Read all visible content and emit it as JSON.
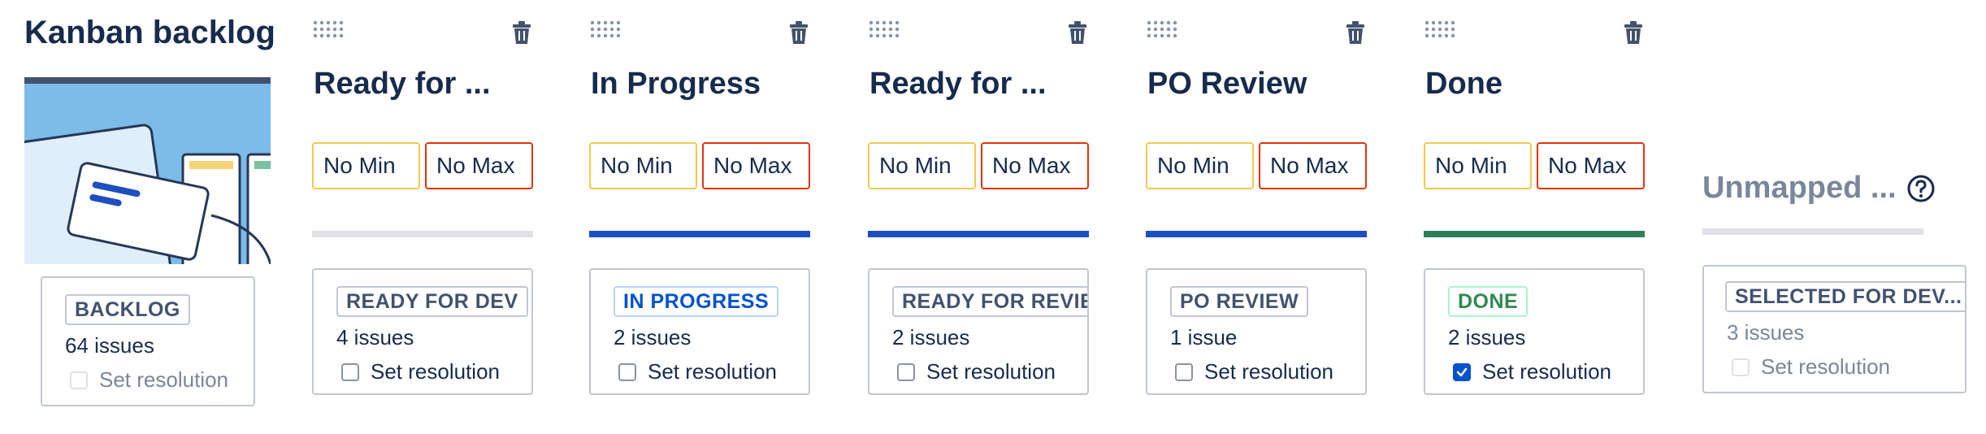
{
  "backlog": {
    "title": "Kanban backlog",
    "card": {
      "status": "BACKLOG",
      "issues": "64 issues",
      "resolution_label": "Set resolution"
    }
  },
  "columns": [
    {
      "title": "Ready for ...",
      "min": "No Min",
      "max": "No Max",
      "bar_color": "#dfe1e6",
      "card": {
        "status": "READY FOR DEV",
        "status_color": "#42526e",
        "issues": "4 issues",
        "resolution_label": "Set resolution",
        "resolution_checked": false
      }
    },
    {
      "title": "In Progress",
      "min": "No Min",
      "max": "No Max",
      "bar_color": "#1d4fbf",
      "card": {
        "status": "IN PROGRESS",
        "status_color": "#0052cc",
        "issues": "2 issues",
        "resolution_label": "Set resolution",
        "resolution_checked": false
      }
    },
    {
      "title": "Ready for ...",
      "min": "No Min",
      "max": "No Max",
      "bar_color": "#1d4fbf",
      "card": {
        "status": "READY FOR REVIEW",
        "status_color": "#42526e",
        "issues": "2 issues",
        "resolution_label": "Set resolution",
        "resolution_checked": false
      }
    },
    {
      "title": "PO Review",
      "min": "No Min",
      "max": "No Max",
      "bar_color": "#1d4fbf",
      "card": {
        "status": "PO REVIEW",
        "status_color": "#42526e",
        "issues": "1 issue",
        "resolution_label": "Set resolution",
        "resolution_checked": false
      }
    },
    {
      "title": "Done",
      "min": "No Min",
      "max": "No Max",
      "bar_color": "#2f7d5b",
      "card": {
        "status": "DONE",
        "status_color": "#2f8a4f",
        "issues": "2 issues",
        "resolution_label": "Set resolution",
        "resolution_checked": true
      }
    }
  ],
  "unmapped": {
    "title": "Unmapped ...",
    "help_icon": "question-circle-icon",
    "bar_color": "#dfe1e6",
    "card": {
      "status": "SELECTED FOR DEV...",
      "issues": "3 issues",
      "resolution_label": "Set resolution"
    }
  },
  "colors": {
    "min_border": "#f2c94c",
    "max_border": "#de350b",
    "text": "#172b4d"
  },
  "icons": {
    "drag": "drag-handle-icon",
    "trash": "trash-icon",
    "check": "check-icon"
  }
}
